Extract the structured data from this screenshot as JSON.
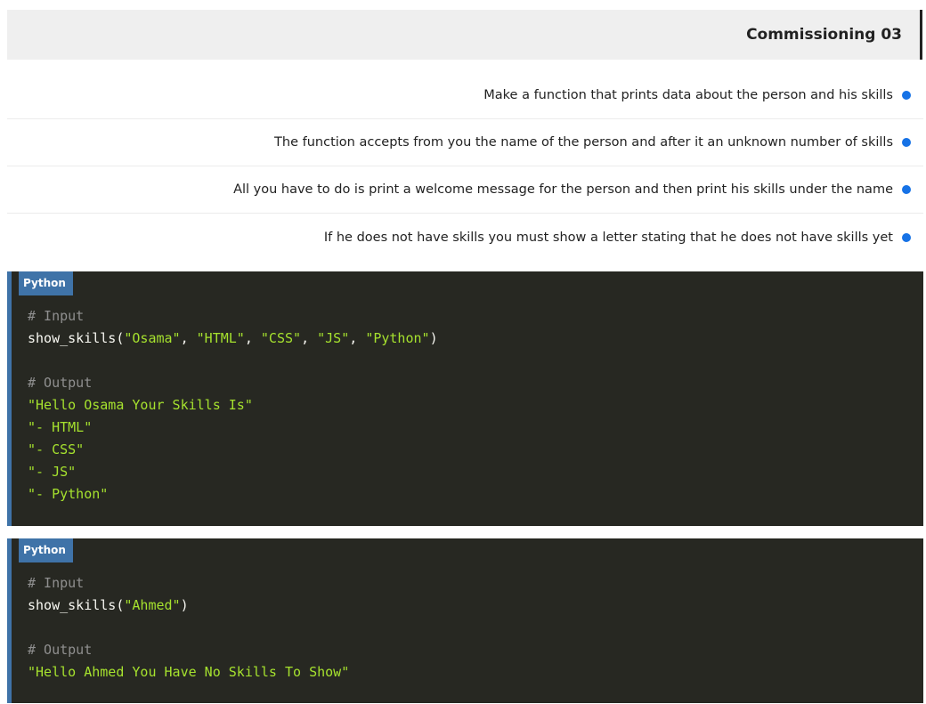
{
  "header": {
    "title": "Commissioning 03"
  },
  "tasks": [
    "Make a function that prints data about the person and his skills",
    "The function accepts from you the name of the person and after it an unknown number of skills",
    "All you have to do is print a welcome message for the person and then print his skills under the name",
    "If he does not have skills you must show a letter stating that he does not have skills yet"
  ],
  "code_blocks": [
    {
      "language": "Python",
      "input_comment": "# Input",
      "call_func": "show_skills(",
      "call_args": [
        "\"Osama\"",
        "\"HTML\"",
        "\"CSS\"",
        "\"JS\"",
        "\"Python\""
      ],
      "call_close": ")",
      "output_comment": "# Output",
      "output_lines": [
        "\"Hello Osama Your Skills Is\"",
        "\"- HTML\"",
        "\"- CSS\"",
        "\"- JS\"",
        "\"- Python\""
      ]
    },
    {
      "language": "Python",
      "input_comment": "# Input",
      "call_func": "show_skills(",
      "call_args": [
        "\"Ahmed\""
      ],
      "call_close": ")",
      "output_comment": "# Output",
      "output_lines": [
        "\"Hello Ahmed You Have No Skills To Show\""
      ]
    }
  ],
  "colors": {
    "accent": "#1672e6",
    "code_bg": "#272822",
    "badge_bg": "#3f73a8",
    "string": "#a6e22e",
    "comment": "#8f8f8f"
  }
}
